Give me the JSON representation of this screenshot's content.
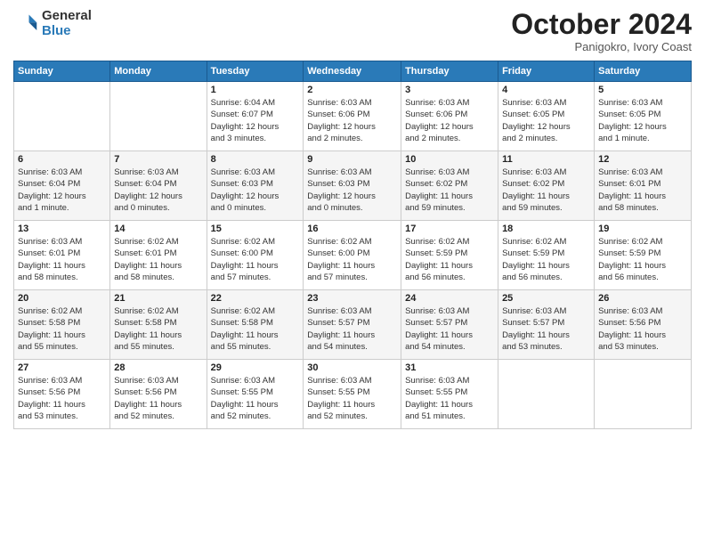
{
  "logo": {
    "general": "General",
    "blue": "Blue"
  },
  "header": {
    "title": "October 2024",
    "subtitle": "Panigokro, Ivory Coast"
  },
  "weekdays": [
    "Sunday",
    "Monday",
    "Tuesday",
    "Wednesday",
    "Thursday",
    "Friday",
    "Saturday"
  ],
  "weeks": [
    [
      {
        "day": "",
        "info": ""
      },
      {
        "day": "",
        "info": ""
      },
      {
        "day": "1",
        "info": "Sunrise: 6:04 AM\nSunset: 6:07 PM\nDaylight: 12 hours\nand 3 minutes."
      },
      {
        "day": "2",
        "info": "Sunrise: 6:03 AM\nSunset: 6:06 PM\nDaylight: 12 hours\nand 2 minutes."
      },
      {
        "day": "3",
        "info": "Sunrise: 6:03 AM\nSunset: 6:06 PM\nDaylight: 12 hours\nand 2 minutes."
      },
      {
        "day": "4",
        "info": "Sunrise: 6:03 AM\nSunset: 6:05 PM\nDaylight: 12 hours\nand 2 minutes."
      },
      {
        "day": "5",
        "info": "Sunrise: 6:03 AM\nSunset: 6:05 PM\nDaylight: 12 hours\nand 1 minute."
      }
    ],
    [
      {
        "day": "6",
        "info": "Sunrise: 6:03 AM\nSunset: 6:04 PM\nDaylight: 12 hours\nand 1 minute."
      },
      {
        "day": "7",
        "info": "Sunrise: 6:03 AM\nSunset: 6:04 PM\nDaylight: 12 hours\nand 0 minutes."
      },
      {
        "day": "8",
        "info": "Sunrise: 6:03 AM\nSunset: 6:03 PM\nDaylight: 12 hours\nand 0 minutes."
      },
      {
        "day": "9",
        "info": "Sunrise: 6:03 AM\nSunset: 6:03 PM\nDaylight: 12 hours\nand 0 minutes."
      },
      {
        "day": "10",
        "info": "Sunrise: 6:03 AM\nSunset: 6:02 PM\nDaylight: 11 hours\nand 59 minutes."
      },
      {
        "day": "11",
        "info": "Sunrise: 6:03 AM\nSunset: 6:02 PM\nDaylight: 11 hours\nand 59 minutes."
      },
      {
        "day": "12",
        "info": "Sunrise: 6:03 AM\nSunset: 6:01 PM\nDaylight: 11 hours\nand 58 minutes."
      }
    ],
    [
      {
        "day": "13",
        "info": "Sunrise: 6:03 AM\nSunset: 6:01 PM\nDaylight: 11 hours\nand 58 minutes."
      },
      {
        "day": "14",
        "info": "Sunrise: 6:02 AM\nSunset: 6:01 PM\nDaylight: 11 hours\nand 58 minutes."
      },
      {
        "day": "15",
        "info": "Sunrise: 6:02 AM\nSunset: 6:00 PM\nDaylight: 11 hours\nand 57 minutes."
      },
      {
        "day": "16",
        "info": "Sunrise: 6:02 AM\nSunset: 6:00 PM\nDaylight: 11 hours\nand 57 minutes."
      },
      {
        "day": "17",
        "info": "Sunrise: 6:02 AM\nSunset: 5:59 PM\nDaylight: 11 hours\nand 56 minutes."
      },
      {
        "day": "18",
        "info": "Sunrise: 6:02 AM\nSunset: 5:59 PM\nDaylight: 11 hours\nand 56 minutes."
      },
      {
        "day": "19",
        "info": "Sunrise: 6:02 AM\nSunset: 5:59 PM\nDaylight: 11 hours\nand 56 minutes."
      }
    ],
    [
      {
        "day": "20",
        "info": "Sunrise: 6:02 AM\nSunset: 5:58 PM\nDaylight: 11 hours\nand 55 minutes."
      },
      {
        "day": "21",
        "info": "Sunrise: 6:02 AM\nSunset: 5:58 PM\nDaylight: 11 hours\nand 55 minutes."
      },
      {
        "day": "22",
        "info": "Sunrise: 6:02 AM\nSunset: 5:58 PM\nDaylight: 11 hours\nand 55 minutes."
      },
      {
        "day": "23",
        "info": "Sunrise: 6:03 AM\nSunset: 5:57 PM\nDaylight: 11 hours\nand 54 minutes."
      },
      {
        "day": "24",
        "info": "Sunrise: 6:03 AM\nSunset: 5:57 PM\nDaylight: 11 hours\nand 54 minutes."
      },
      {
        "day": "25",
        "info": "Sunrise: 6:03 AM\nSunset: 5:57 PM\nDaylight: 11 hours\nand 53 minutes."
      },
      {
        "day": "26",
        "info": "Sunrise: 6:03 AM\nSunset: 5:56 PM\nDaylight: 11 hours\nand 53 minutes."
      }
    ],
    [
      {
        "day": "27",
        "info": "Sunrise: 6:03 AM\nSunset: 5:56 PM\nDaylight: 11 hours\nand 53 minutes."
      },
      {
        "day": "28",
        "info": "Sunrise: 6:03 AM\nSunset: 5:56 PM\nDaylight: 11 hours\nand 52 minutes."
      },
      {
        "day": "29",
        "info": "Sunrise: 6:03 AM\nSunset: 5:55 PM\nDaylight: 11 hours\nand 52 minutes."
      },
      {
        "day": "30",
        "info": "Sunrise: 6:03 AM\nSunset: 5:55 PM\nDaylight: 11 hours\nand 52 minutes."
      },
      {
        "day": "31",
        "info": "Sunrise: 6:03 AM\nSunset: 5:55 PM\nDaylight: 11 hours\nand 51 minutes."
      },
      {
        "day": "",
        "info": ""
      },
      {
        "day": "",
        "info": ""
      }
    ]
  ]
}
